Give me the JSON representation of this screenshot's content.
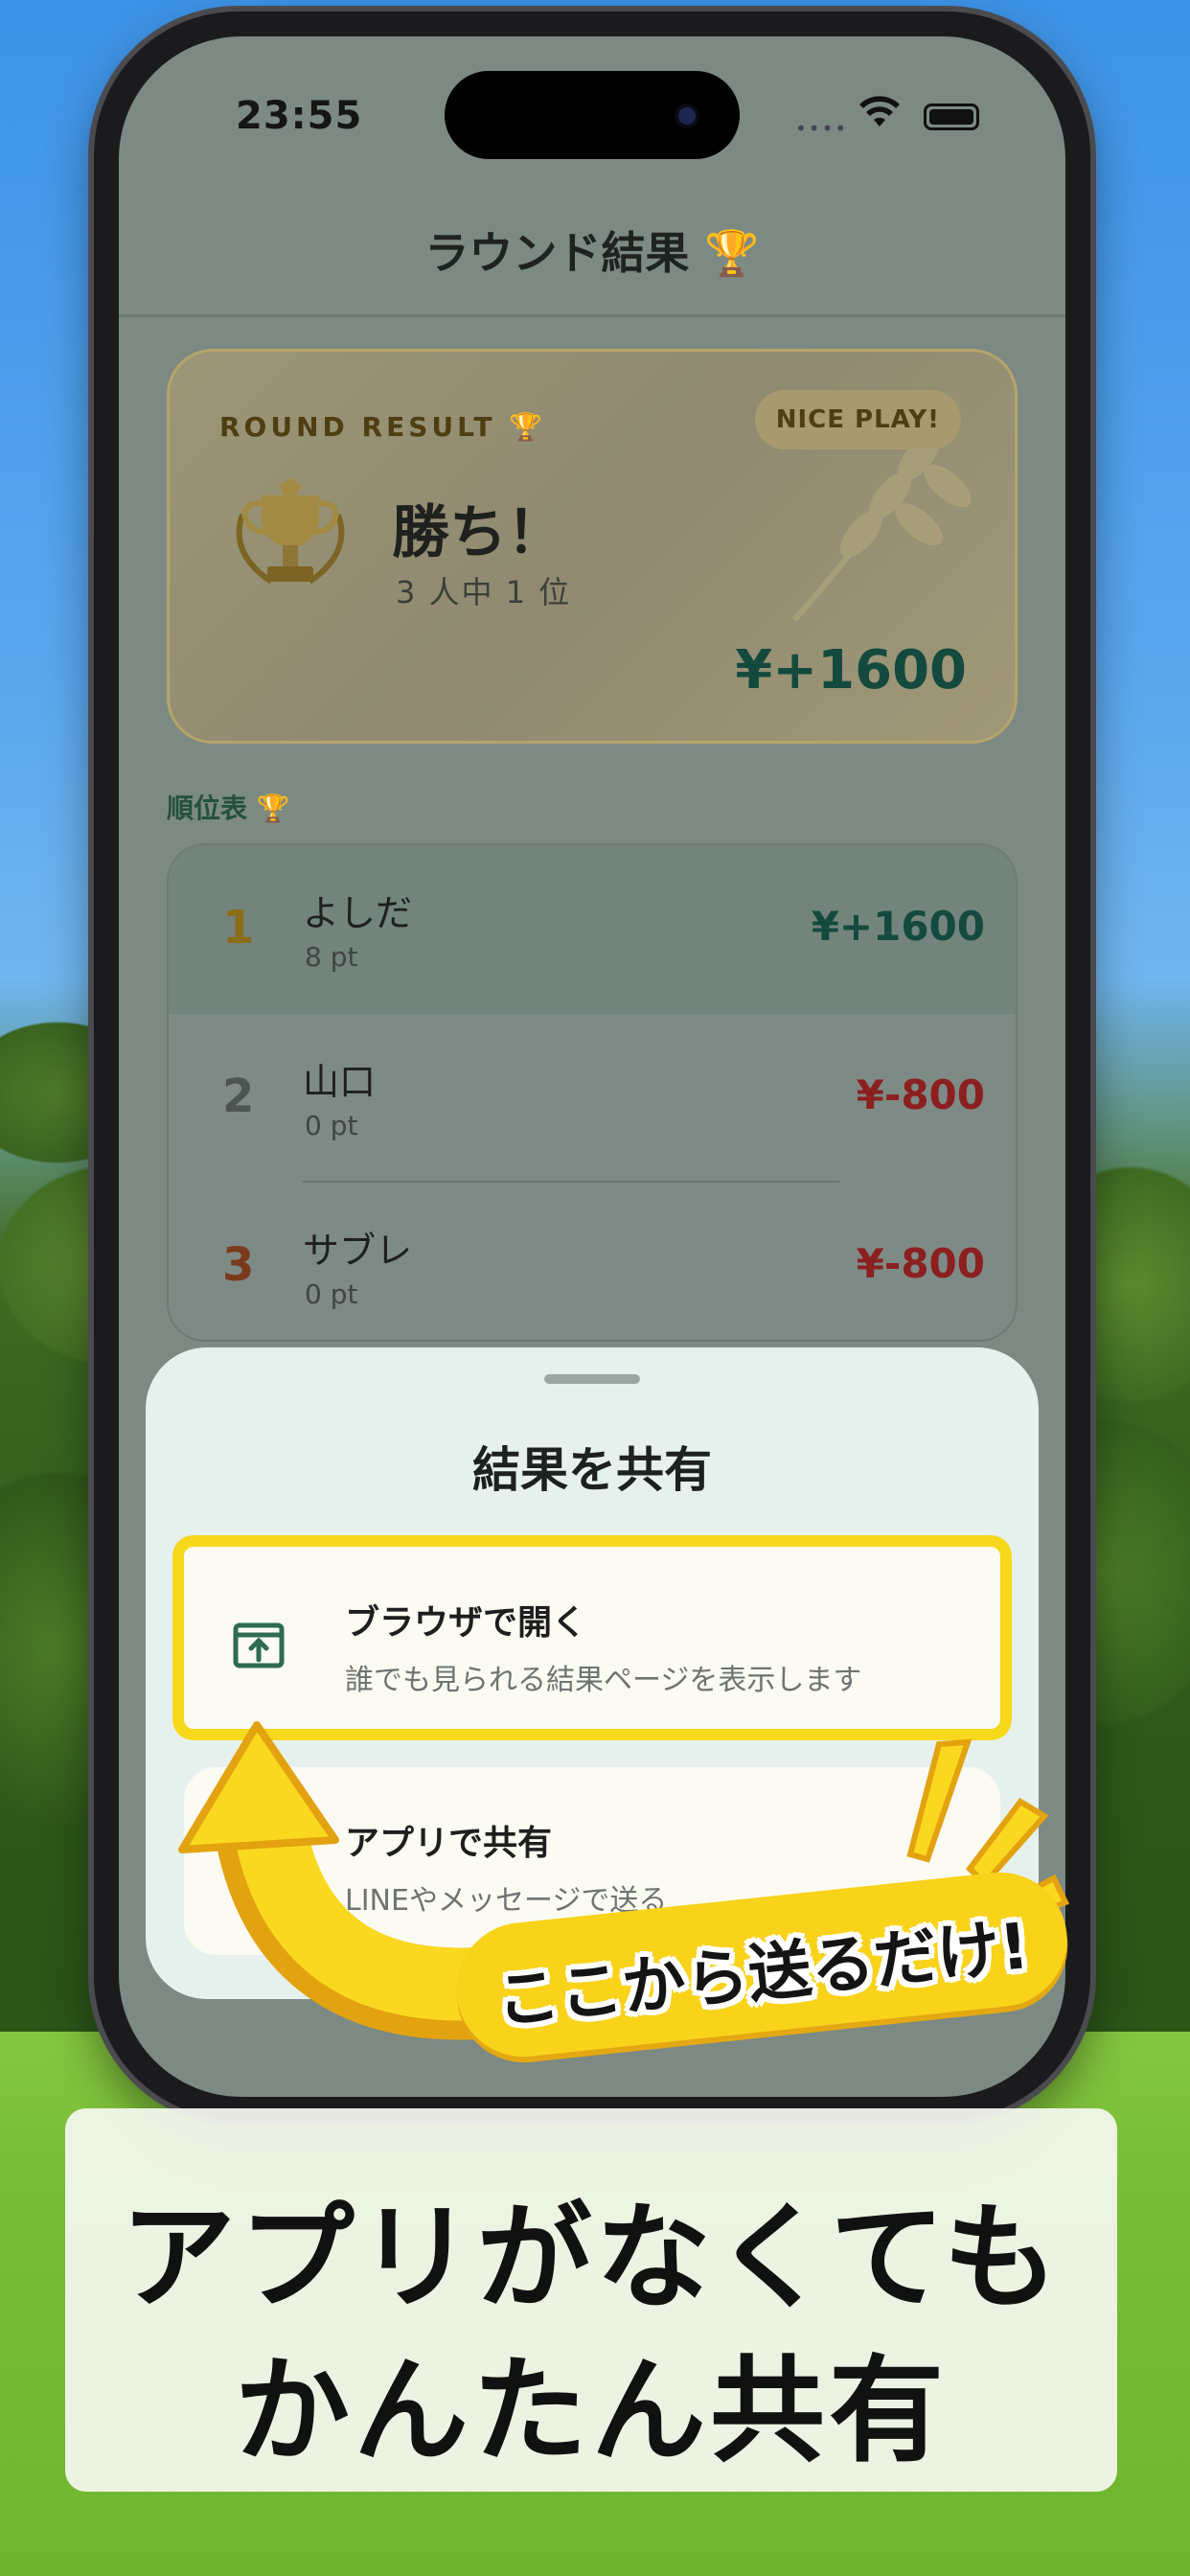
{
  "status_bar": {
    "time": "23:55",
    "signal": "••••"
  },
  "nav": {
    "title": "ラウンド結果 🏆"
  },
  "result_card": {
    "label": "ROUND RESULT 🏆",
    "badge": "NICE PLAY!",
    "title": "勝ち！",
    "subtitle": "3 人中 1 位",
    "amount": "¥+1600"
  },
  "ranking": {
    "heading": "順位表 🏆",
    "rows": [
      {
        "rank": "1",
        "name": "よしだ",
        "points": "8 pt",
        "amount": "¥+1600"
      },
      {
        "rank": "2",
        "name": "山口",
        "points": "0 pt",
        "amount": "¥-800"
      },
      {
        "rank": "3",
        "name": "サブレ",
        "points": "0 pt",
        "amount": "¥-800"
      }
    ]
  },
  "share_sheet": {
    "title": "結果を共有",
    "options": [
      {
        "title": "ブラウザで開く",
        "description": "誰でも見られる結果ページを表示します"
      },
      {
        "title": "アプリで共有",
        "description": "LINEやメッセージで送る"
      }
    ]
  },
  "callout": {
    "text": "ここから送るだけ!"
  },
  "caption": {
    "line1": "アプリがなくても",
    "line2": "かんたん共有"
  },
  "colors": {
    "accent_yellow": "#f7d81b",
    "positive": "#144a3e",
    "negative": "#8c1f1f",
    "rank1": "#8a6d16",
    "rank2": "#4d5553",
    "rank3": "#7a3a1c"
  }
}
